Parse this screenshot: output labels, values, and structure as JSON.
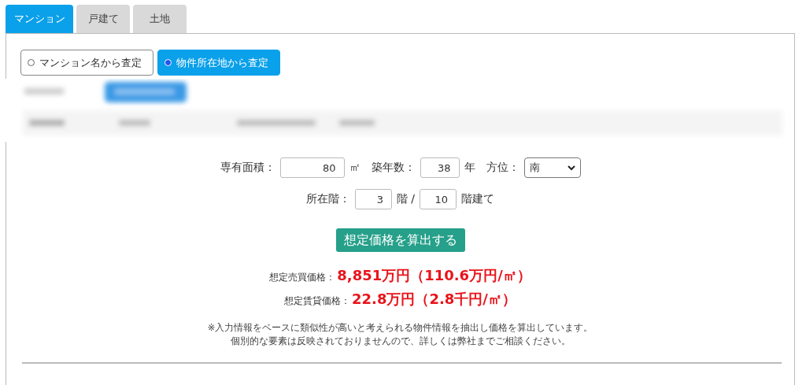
{
  "tabs": [
    {
      "label": "マンション",
      "selected": true
    },
    {
      "label": "戸建て",
      "selected": false
    },
    {
      "label": "土地",
      "selected": false
    }
  ],
  "modes": [
    {
      "label": "マンション名から査定",
      "selected": false
    },
    {
      "label": "物件所在地から査定",
      "selected": true
    }
  ],
  "blurred_area": {
    "kind": "picture"
  },
  "form": {
    "area": {
      "label": "専有面積：",
      "value": "80",
      "unit": "㎡"
    },
    "age": {
      "label": "築年数：",
      "value": "38",
      "unit": "年"
    },
    "direction": {
      "label": "方位：",
      "value": "南"
    },
    "floor": {
      "label": "所在階：",
      "value": "3",
      "separator": "階 /",
      "total": "10",
      "suffix": "階建て"
    }
  },
  "calculate_button": "想定価格を算出する",
  "results": [
    {
      "label": "想定売買価格：",
      "value": "8,851万円（110.6万円/㎡）"
    },
    {
      "label": "想定賃貸価格：",
      "value": "22.8万円（2.8千円/㎡）"
    }
  ],
  "notes": [
    "※入力情報をベースに類似性が高いと考えられる物件情報を抽出し価格を算出しています。",
    "個別的な要素は反映されておりませんので、詳しくは弊社までご相談ください。"
  ]
}
